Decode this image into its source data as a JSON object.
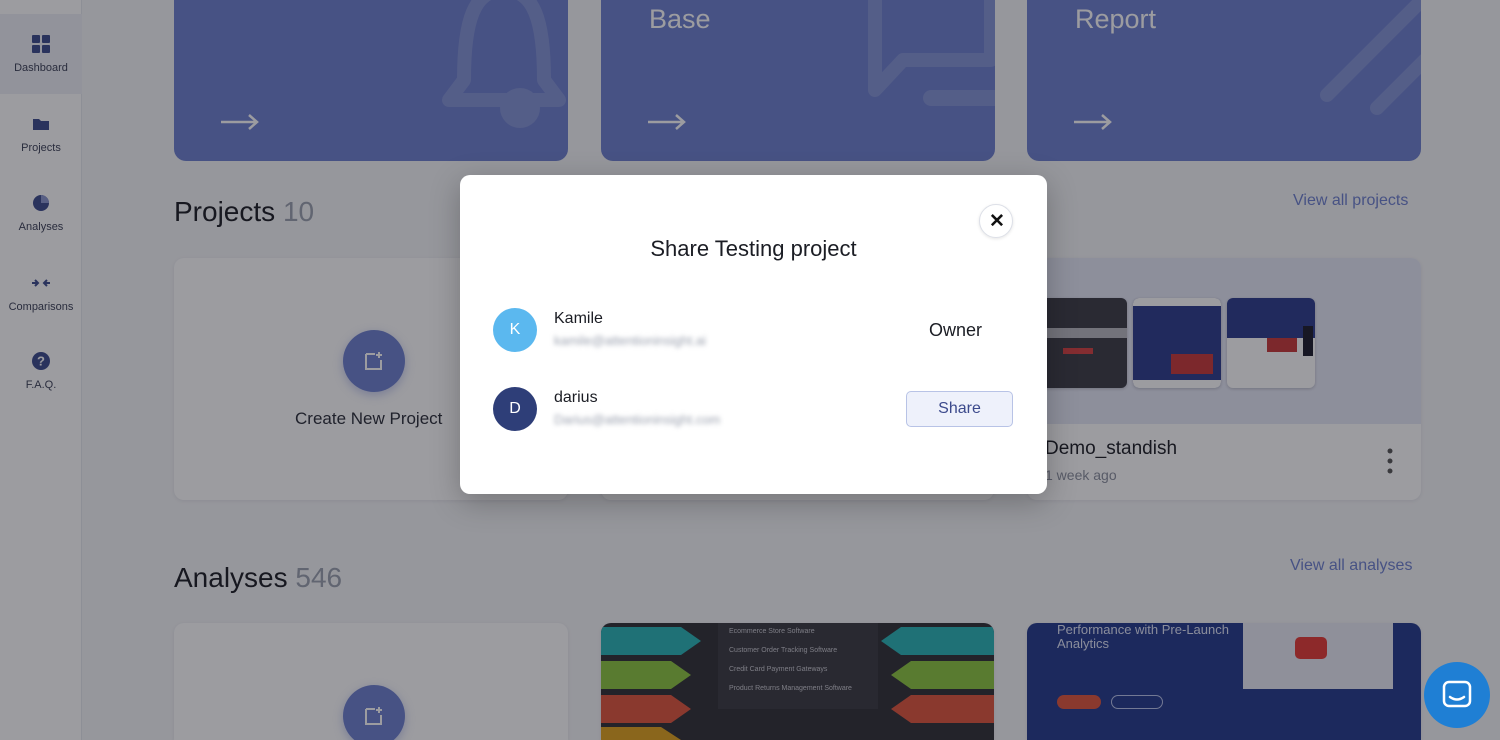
{
  "sidebar": {
    "items": [
      {
        "label": "Dashboard",
        "icon": "grid-icon"
      },
      {
        "label": "Projects",
        "icon": "folder-icon"
      },
      {
        "label": "Analyses",
        "icon": "pie-icon"
      },
      {
        "label": "Comparisons",
        "icon": "compare-arrows-icon"
      },
      {
        "label": "F.A.Q.",
        "icon": "question-icon"
      }
    ]
  },
  "top_cards": [
    {
      "title": "",
      "icon": "bell-icon"
    },
    {
      "title": "Base",
      "icon": "chat-bubble-icon"
    },
    {
      "title": "Report",
      "icon": "stripes-icon"
    }
  ],
  "projects": {
    "title": "Projects",
    "count": "10",
    "view_all": "View all projects",
    "create_label": "Create New Project",
    "card": {
      "name": "Demo_standish",
      "time": "1 week ago"
    }
  },
  "analyses": {
    "title": "Analyses",
    "count": "546",
    "view_all": "View all analyses",
    "thumb_lines": [
      "Ecommerce Store Software",
      "Customer Order Tracking Software",
      "Credit Card Payment Gateways",
      "Product Returns Management Software"
    ],
    "promo_title": "Performance with Pre-Launch Analytics"
  },
  "modal": {
    "title": "Share Testing project",
    "close_icon": "close-icon",
    "users": [
      {
        "initial": "K",
        "name": "Kamile",
        "email": "kamile@attentioninsight.ai",
        "role": "Owner",
        "avatar_color": "#5bb8ef"
      },
      {
        "initial": "D",
        "name": "darius",
        "email": "Darius@attentioninsight.com",
        "action": "Share",
        "avatar_color": "#2e3e78"
      }
    ]
  },
  "colors": {
    "accent": "#6d80cf",
    "chat": "#1f7fd4"
  }
}
